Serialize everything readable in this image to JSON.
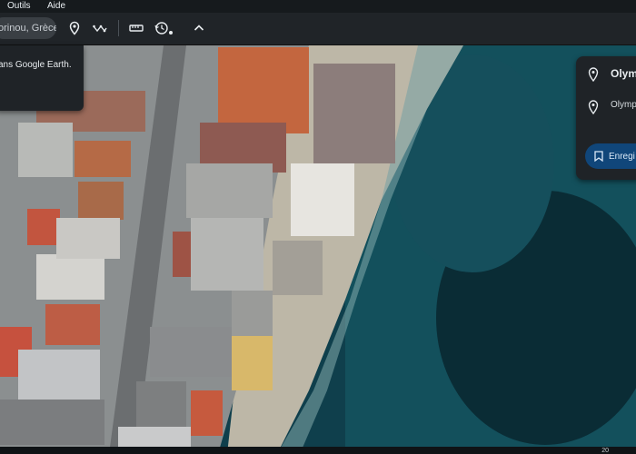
{
  "menu": {
    "tools": "Outils",
    "help": "Aide"
  },
  "search": {
    "value": "orinou, Grèce"
  },
  "toolbar": {
    "icons": [
      "location-pin-icon",
      "path-icon",
      "ruler-icon",
      "history-icon",
      "chevron-up-icon"
    ]
  },
  "popup_left": {
    "text": "ans Google Earth."
  },
  "panel_right": {
    "title": "Olym",
    "subtitle": "Olymp",
    "save_label": "Enregi"
  },
  "footer": {
    "readout": "20"
  }
}
